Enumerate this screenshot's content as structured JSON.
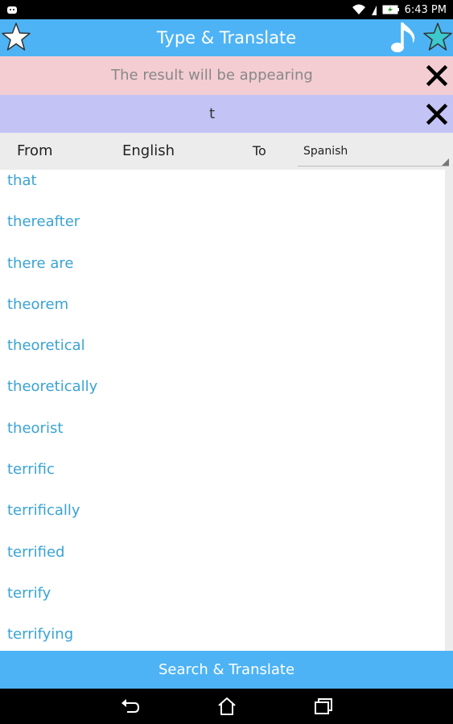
{
  "status_bar": {
    "time": "6:43 PM",
    "left_icon": "android-notification-icon",
    "icons": [
      "wifi-icon",
      "signal-icon",
      "battery-charging-icon"
    ]
  },
  "app_bar": {
    "title": "Type & Translate",
    "left_icon": "star-outline-icon",
    "music_icon": "music-note-icon",
    "right_icon": "star-filled-icon"
  },
  "result": {
    "text": "The result will be appearing"
  },
  "input": {
    "value": "t"
  },
  "languages": {
    "from_label": "From",
    "from_value": "English",
    "to_label": "To",
    "to_value": "Spanish"
  },
  "suggestions": [
    "that",
    "thereafter",
    "there are",
    "theorem",
    "theoretical",
    "theoretically",
    "theorist",
    "terrific",
    "terrifically",
    "terrified",
    "terrify",
    "terrifying"
  ],
  "bottom_button": {
    "label": "Search & Translate"
  },
  "colors": {
    "accent": "#4db3f5",
    "result_bg": "#f4cdd2",
    "input_bg": "#c3c3f5",
    "link": "#3aa3d4",
    "star_right": "#3cc8cc"
  }
}
